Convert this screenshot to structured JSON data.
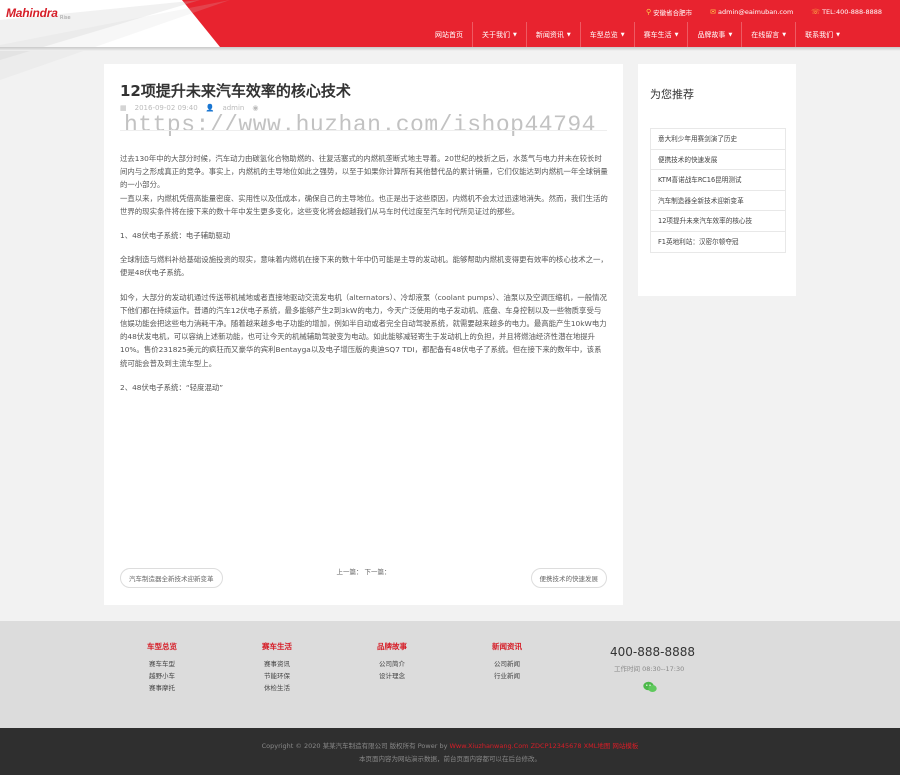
{
  "header": {
    "logo_text": "Mahindra",
    "logo_sub": "Rise",
    "topbar": [
      {
        "icon": "map-pin-icon",
        "text": "安徽省合肥市"
      },
      {
        "icon": "mail-icon",
        "text": "admin@eaimuban.com"
      },
      {
        "icon": "phone-icon",
        "text": "TEL:400-888-8888"
      }
    ],
    "nav": [
      {
        "label": "网站首页",
        "dropdown": false
      },
      {
        "label": "关于我们",
        "dropdown": true
      },
      {
        "label": "新闻资讯",
        "dropdown": true
      },
      {
        "label": "车型总览",
        "dropdown": true
      },
      {
        "label": "赛车生活",
        "dropdown": true
      },
      {
        "label": "品牌故事",
        "dropdown": true
      },
      {
        "label": "在线留言",
        "dropdown": true
      },
      {
        "label": "联系我们",
        "dropdown": true
      }
    ]
  },
  "article": {
    "title": "12项提升未来汽车效率的核心技术",
    "date": "2016-09-02 09:40",
    "author": "admin",
    "watermark": "https://www.huzhan.com/ishop44794",
    "paragraphs": [
      "过去130年中的大部分时候，汽车动力由碳氢化合物助燃的、往复活塞式的内燃机垄断式地主导着。20世纪的枝折之后，水蒸气与电力并未在较长时间内与之形成真正的竞争。事实上，内燃机的主导地位如此之强势，以至于如果你计算所有其他替代品的累计销量，它们仅能达到内燃机一年全球销量的一小部分。",
      "一直以来，内燃机凭借高能量密度、实用性以及低成本，确保自己的主导地位。也正是出于这些原因，内燃机不会太过迅速地消失。然而，我们生活的世界的现实条件将在接下来的数十年中发生更多变化，这些变化将会超越我们从马车时代过度至汽车时代所见证过的那些。",
      "1、48伏电子系统：电子辅助驱动",
      "全球制造与燃料补给基础设施投资的现实，意味着内燃机在接下来的数十年中仍可能是主导的发动机。能够帮助内燃机变得更有效率的核心技术之一，便是48伏电子系统。",
      "如今，大部分的发动机通过传送带机械地或者直接地驱动交流发电机（alternators）、冷却液泵（coolant pumps）、油泵以及空调压缩机，一般情况下他们都在持续运作。普通的汽车12伏电子系统，最多能够产生2到3kW的电力，今天广泛使用的电子发动机、底盘、车身控制以及一些物质享受与信娱功能会把这些电力消耗干净。随着越来越多电子功能的增加，例如半自动或者完全自动驾驶系统，就需要越来越多的电力。最高能产生10kW电力的48伏发电机，可以容纳上述新功能，也可让今天的机械辅助驾驶变为电动。如此能够减轻寄生于发动机上的负担，并且将燃油经济性潜在地提升10%。售价231825美元的疯狂而又豪华的宾利Bentayga以及电子增压版的奥迪SQ7 TDI，都配备有48伏电子了系统。但在接下来的数年中，该系统可能会普及到主流车型上。",
      "2、48伏电子系统：“轻度混动”"
    ],
    "pager_center": "上一篇： 下一篇：",
    "prev_label": "汽车制造器全新技术迎新变革",
    "next_label": "便携技术的快速发展"
  },
  "sidebar": {
    "title": "为您推荐",
    "items": [
      "意大利少年用赛剑演了历史",
      "便携技术的快速发展",
      "KTM喜诺战车RC16昆明测试",
      "汽车制造器全新技术迎新变革",
      "12项提升未来汽车效率的核心技",
      "F1英地利站：汉密尔顿夺冠"
    ]
  },
  "footer": {
    "columns": [
      {
        "title": "车型总览",
        "links": [
          "赛车车型",
          "越野小车",
          "赛事摩托"
        ]
      },
      {
        "title": "赛车生活",
        "links": [
          "赛事资讯",
          "节能环保",
          "休检生活"
        ]
      },
      {
        "title": "品牌故事",
        "links": [
          "公司简介",
          "设计理念"
        ]
      },
      {
        "title": "新闻资讯",
        "links": [
          "公司新闻",
          "行业新闻"
        ]
      }
    ],
    "phone": "400-888-8888",
    "hours": "工作时间 08:30--17:30",
    "copyright_prefix": "Copyright © 2020 某某汽车制造有限公司 版权所有 Power by",
    "copyright_link": "Www.Xiuzhanwang.Com ZDCP12345678 XML地图 网站模板",
    "disclaimer": "本页面内容为网站演示数据，前台页面内容都可以在后台修改。"
  },
  "colors": {
    "brand_red": "#e8232f",
    "footer_bg": "#dcdcdc",
    "bottom_bg": "#2f2f2f"
  }
}
